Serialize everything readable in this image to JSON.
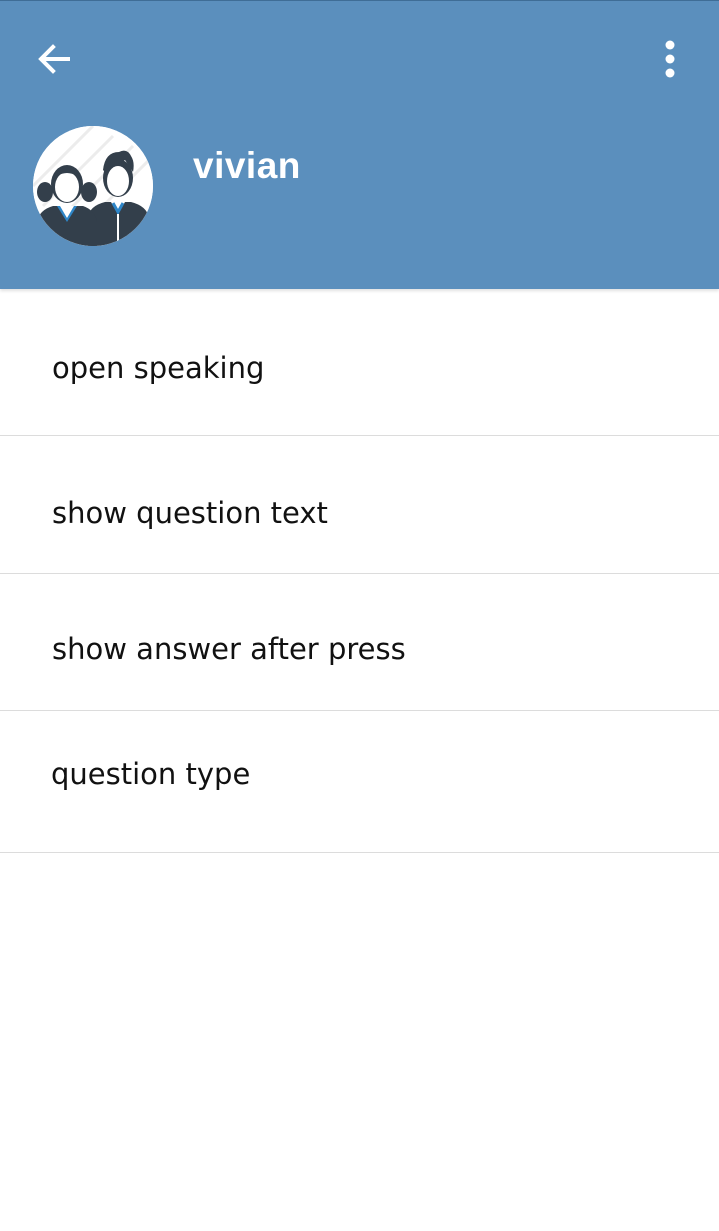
{
  "colors": {
    "header_background": "#5b8fbd",
    "header_text": "#ffffff",
    "list_text": "#111111",
    "divider": "#dcdcdc"
  },
  "header": {
    "back_icon": "arrow-left-icon",
    "menu_icon": "more-vert-icon",
    "avatar_icon": "students-avatar-icon",
    "name": "vivian"
  },
  "settings": {
    "items": [
      {
        "label": "open speaking"
      },
      {
        "label": "show question text"
      },
      {
        "label": "show answer after press"
      },
      {
        "label": "question type"
      }
    ]
  }
}
